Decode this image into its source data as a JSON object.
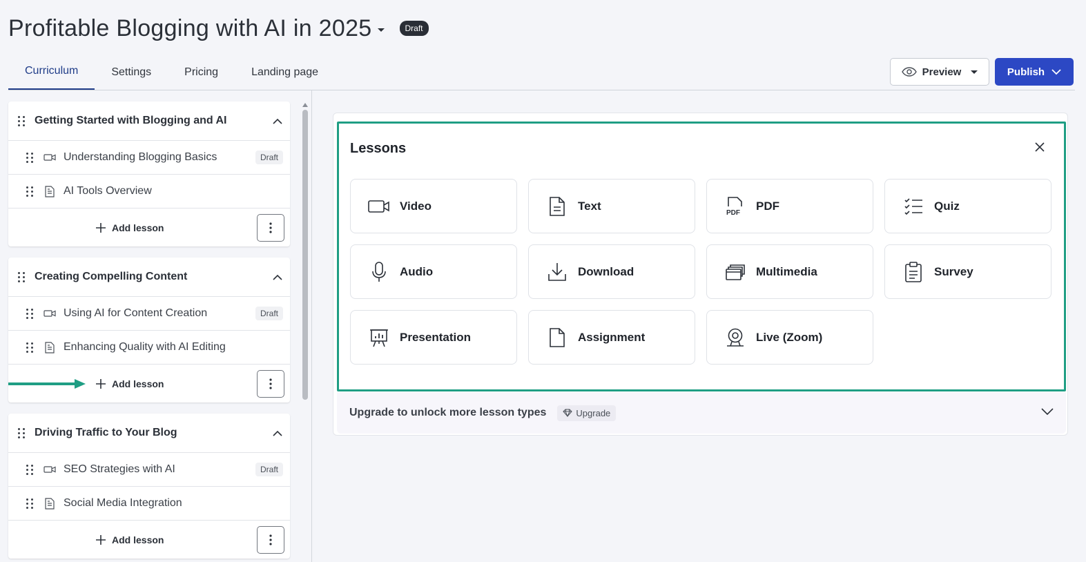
{
  "header": {
    "course_title": "Profitable Blogging with AI in 2025",
    "status_badge": "Draft",
    "tabs": [
      {
        "label": "Curriculum",
        "active": true
      },
      {
        "label": "Settings",
        "active": false
      },
      {
        "label": "Pricing",
        "active": false
      },
      {
        "label": "Landing page",
        "active": false
      }
    ],
    "preview_label": "Preview",
    "publish_label": "Publish"
  },
  "sidebar": {
    "sections": [
      {
        "title": "Getting Started with Blogging and AI",
        "lessons": [
          {
            "name": "Understanding Blogging Basics",
            "icon": "video-icon",
            "badge": "Draft"
          },
          {
            "name": "AI Tools Overview",
            "icon": "text-doc-icon",
            "badge": ""
          }
        ],
        "add_label": "Add lesson"
      },
      {
        "title": "Creating Compelling Content",
        "lessons": [
          {
            "name": "Using AI for Content Creation",
            "icon": "video-icon",
            "badge": "Draft"
          },
          {
            "name": "Enhancing Quality with AI Editing",
            "icon": "text-doc-icon",
            "badge": ""
          }
        ],
        "add_label": "Add lesson"
      },
      {
        "title": "Driving Traffic to Your Blog",
        "lessons": [
          {
            "name": "SEO Strategies with AI",
            "icon": "video-icon",
            "badge": "Draft"
          },
          {
            "name": "Social Media Integration",
            "icon": "text-doc-icon",
            "badge": ""
          }
        ],
        "add_label": "Add lesson"
      }
    ]
  },
  "lessons_panel": {
    "title": "Lessons",
    "types": [
      {
        "label": "Video",
        "icon": "video-icon"
      },
      {
        "label": "Text",
        "icon": "text-icon"
      },
      {
        "label": "PDF",
        "icon": "pdf-icon"
      },
      {
        "label": "Quiz",
        "icon": "quiz-icon"
      },
      {
        "label": "Audio",
        "icon": "microphone-icon"
      },
      {
        "label": "Download",
        "icon": "download-icon"
      },
      {
        "label": "Multimedia",
        "icon": "multimedia-icon"
      },
      {
        "label": "Survey",
        "icon": "clipboard-icon"
      },
      {
        "label": "Presentation",
        "icon": "presentation-icon"
      },
      {
        "label": "Assignment",
        "icon": "file-icon"
      },
      {
        "label": "Live (Zoom)",
        "icon": "webcam-icon"
      }
    ],
    "upgrade_text": "Upgrade to unlock more lesson types",
    "upgrade_badge": "Upgrade"
  },
  "colors": {
    "accent_blue": "#2c48c4",
    "tab_active": "#1f3c88",
    "highlight_green": "#1f9e84"
  }
}
